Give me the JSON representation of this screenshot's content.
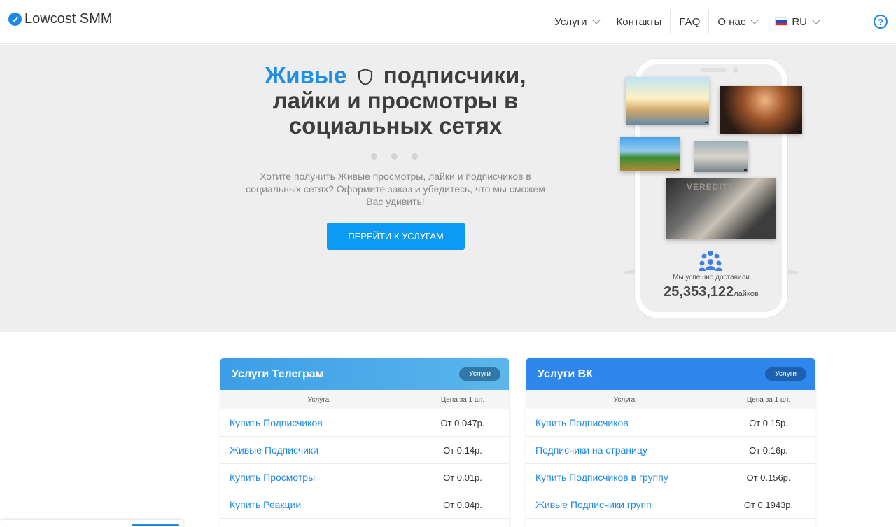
{
  "header": {
    "logo_text": "Lowcost SMM",
    "nav": [
      {
        "label": "Услуги",
        "dropdown": true
      },
      {
        "label": "Контакты",
        "dropdown": false
      },
      {
        "label": "FAQ",
        "dropdown": false
      },
      {
        "label": "О нас",
        "dropdown": true
      },
      {
        "label": "RU",
        "dropdown": true,
        "flag": "ru-flag-icon"
      }
    ],
    "help_icon": "question-circle-icon",
    "help_glyph": "?"
  },
  "hero": {
    "title_highlight": "Живые",
    "title_rest_line1": "подписчики,",
    "title_line2": "лайки и просмотры в",
    "title_line3": "социальных сетях",
    "description": "Хотите получить Живые просмотры, лайки и подписчиков в социальных сетях? Оформите заказ и убедитесь, что мы сможем Вас удивить!",
    "cta_label": "ПЕРЕЙТИ К УСЛУГАМ",
    "delivered_label": "Мы успешно доставили",
    "delivered_count": "25,353,122",
    "delivered_unit": "лайков",
    "thumb_word": "VEREDITY"
  },
  "colors": {
    "accent": "#1e88e5",
    "cta": "#0d9af5",
    "title_blue": "#1e90e8",
    "telegram_head": "#3b9ee6",
    "vk_head": "#2f86ec"
  },
  "cards": {
    "telegram": {
      "title": "Услуги Телеграм",
      "badge": "Услуги",
      "col_service": "Услуга",
      "col_price": "Цена за 1 шт.",
      "rows": [
        {
          "name": "Купить Подписчиков",
          "price": "От 0.047р."
        },
        {
          "name": "Живые Подписчики",
          "price": "От 0.14р."
        },
        {
          "name": "Купить Просмотры",
          "price": "От 0.01р."
        },
        {
          "name": "Купить Реакции",
          "price": "От 0.04р."
        }
      ]
    },
    "vk": {
      "title": "Услуги ВК",
      "badge": "Услуги",
      "col_service": "Услуга",
      "col_price": "Цена за 1 шт.",
      "rows": [
        {
          "name": "Купить Подписчиков",
          "price": "От 0.15р."
        },
        {
          "name": "Подписчики на страницу",
          "price": "От 0.16р."
        },
        {
          "name": "Купить Подписчиков в группу",
          "price": "От 0.156р."
        },
        {
          "name": "Живые Подписчики групп",
          "price": "От 0.1943р."
        }
      ]
    }
  }
}
